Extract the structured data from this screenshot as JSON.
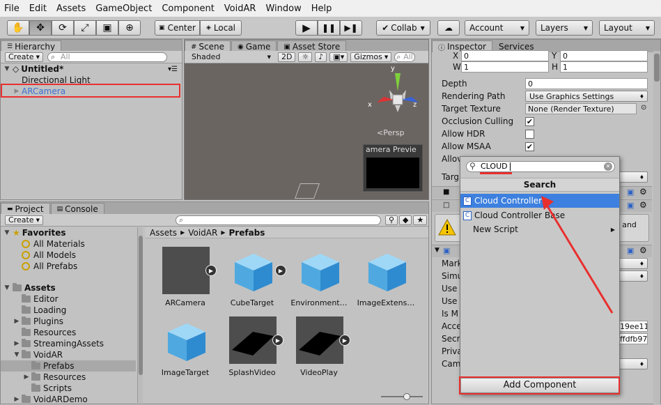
{
  "menu": [
    "File",
    "Edit",
    "Assets",
    "GameObject",
    "Component",
    "VoidAR",
    "Window",
    "Help"
  ],
  "toolbar": {
    "pivot_center": "Center",
    "pivot_local": "Local",
    "collab": "Collab",
    "account": "Account",
    "layers": "Layers",
    "layout": "Layout"
  },
  "hierarchy": {
    "tab": "Hierarchy",
    "create": "Create",
    "search_placeholder": "All",
    "scene": "Untitled*",
    "items": [
      "Directional Light",
      "ARCamera"
    ]
  },
  "scene_view": {
    "tabs": [
      "Scene",
      "Game",
      "Asset Store"
    ],
    "shading": "Shaded",
    "mode_2d": "2D",
    "gizmos": "Gizmos",
    "search_placeholder": "All",
    "persp": "Persp",
    "preview_title": "amera Previe",
    "axis_y": "y",
    "axis_x": "x",
    "axis_z": "z"
  },
  "project": {
    "tabs": [
      "Project",
      "Console"
    ],
    "create": "Create",
    "favorites_label": "Favorites",
    "favorites": [
      "All Materials",
      "All Models",
      "All Prefabs"
    ],
    "assets_label": "Assets",
    "tree": [
      "Editor",
      "Loading",
      "Plugins",
      "Resources",
      "StreamingAssets",
      "VoidAR",
      "Prefabs",
      "Resources",
      "Scripts",
      "VoidARDemo"
    ],
    "breadcrumb": [
      "Assets",
      "VoidAR",
      "Prefabs"
    ],
    "grid_items": [
      "ARCamera",
      "CubeTarget",
      "Environment…",
      "ImageExtens…",
      "ImageTarget",
      "SplashVideo",
      "VideoPlay"
    ]
  },
  "inspector": {
    "tabs": [
      "Inspector",
      "Services"
    ],
    "x_label": "X",
    "x_value": "0",
    "y_label": "Y",
    "y_value": "0",
    "w_label": "W",
    "w_value": "1",
    "h_label": "H",
    "h_value": "1",
    "depth_label": "Depth",
    "depth_value": "0",
    "rendering_path_label": "Rendering Path",
    "rendering_path_value": "Use Graphics Settings",
    "target_texture_label": "Target Texture",
    "target_texture_value": "None (Render Texture)",
    "occlusion_label": "Occlusion Culling",
    "hdr_label": "Allow HDR",
    "msaa_label": "Allow MSAA",
    "allow_partial": "Allov",
    "targ_partial": "Targ",
    "msg_partial": "m and",
    "script_rows": [
      "Mark",
      "Simu",
      "Use",
      "Use",
      "Is M",
      "Acce",
      "Secr",
      "Priva",
      "Cam"
    ],
    "accel_partial": "19ee11",
    "secret_partial": "ffdfb97"
  },
  "add_component": {
    "search_value": "CLOUD",
    "header": "Search",
    "results": [
      "Cloud Controller",
      "Cloud Controller Base",
      "New Script"
    ],
    "button": "Add Component"
  },
  "colors": {
    "highlight": "#3d80df",
    "annotation_red": "#e8302e",
    "scene_bg": "#6b6562"
  }
}
